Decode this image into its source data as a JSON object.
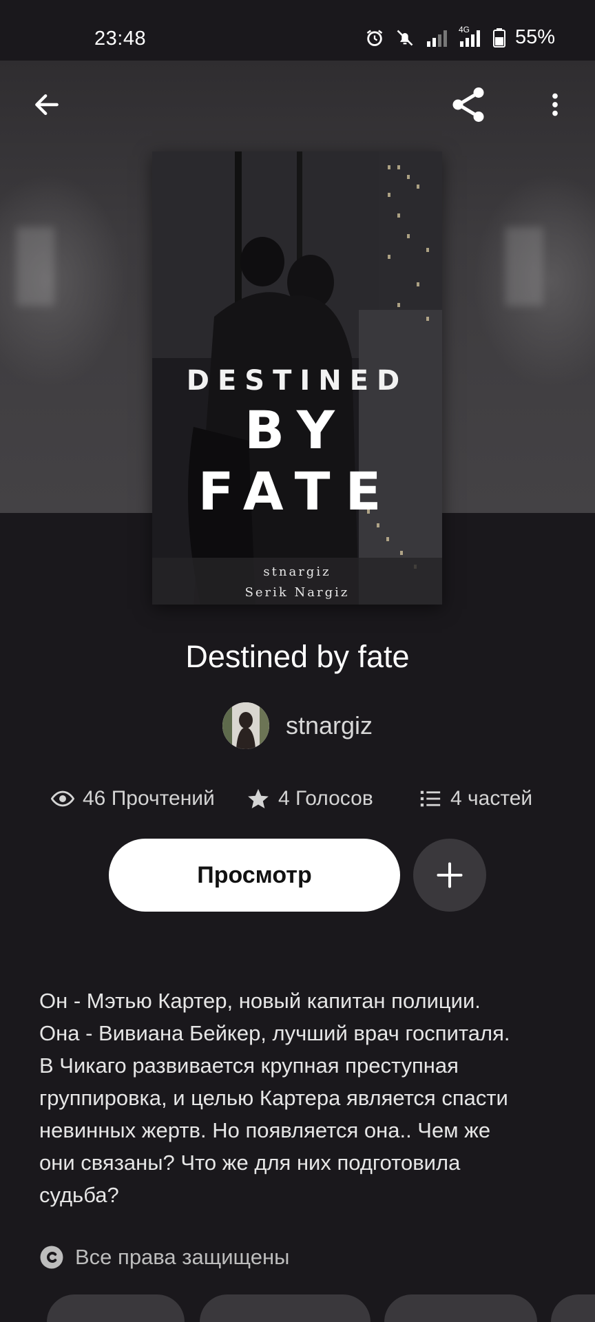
{
  "status_bar": {
    "time": "23:48",
    "network": "4G",
    "battery": "55%",
    "icons": [
      "alarm-icon",
      "mute-icon",
      "signal-icon",
      "signal-4g-icon",
      "battery-icon"
    ]
  },
  "toolbar": {
    "back_icon": "arrow-left-icon",
    "share_icon": "share-icon",
    "more_icon": "more-vertical-icon"
  },
  "cover": {
    "title_line_1": "DESTINED",
    "title_line_2": "BY FATE",
    "author_line_1": "stnargiz",
    "author_line_2": "Serik Nargiz"
  },
  "story": {
    "title": "Destined by fate",
    "author": "stnargiz",
    "reads": "46 Прочтений",
    "votes": "4 Голосов",
    "parts": "4 частей",
    "read_button": "Просмотр",
    "add_icon": "plus-icon",
    "description": "Он - Мэтью Картер, новый капитан полиции.\nОна - Вивиана Бейкер, лучший врач госпиталя.\nВ Чикаго развивается крупная преступная\nгруппировка, и целью Картера является спасти\nневинных жертв. Но появляется она.. Чем же\nони связаны? Что же для них подготовила\nсудьба?",
    "copyright": "Все права защищены"
  },
  "colors": {
    "background": "#1a181c",
    "hero": "#3b393c",
    "button_primary": "#ffffff",
    "button_secondary": "#3a383c"
  }
}
